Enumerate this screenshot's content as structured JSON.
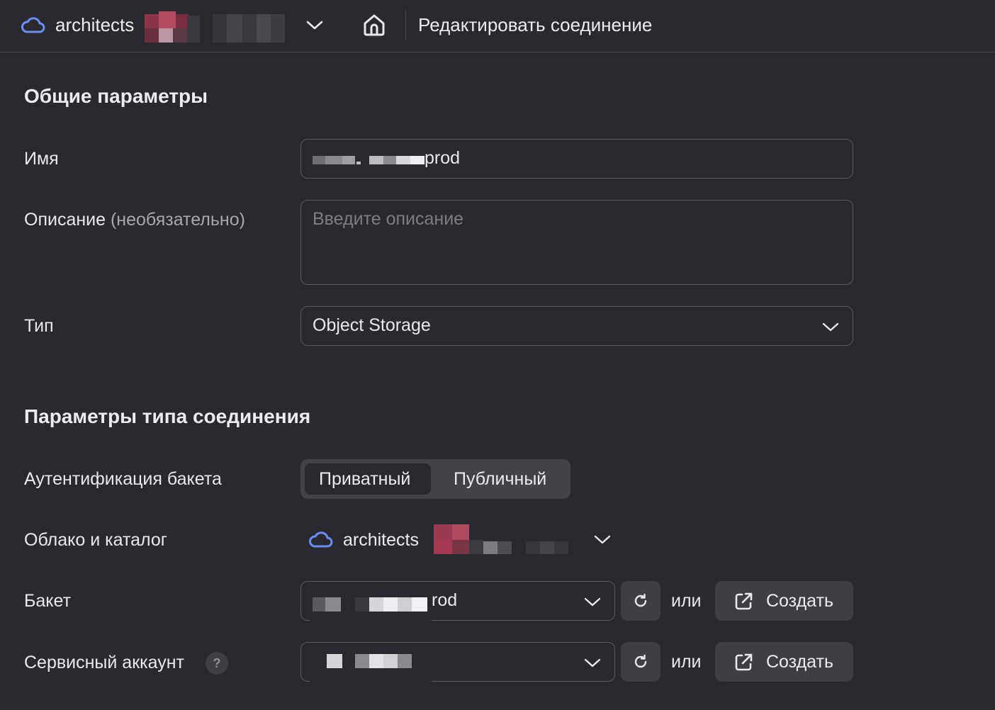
{
  "header": {
    "cloud_name": "architects",
    "page_title": "Редактировать соединение"
  },
  "general": {
    "title": "Общие параметры",
    "name_label": "Имя",
    "name_value": "prod",
    "description_label": "Описание",
    "description_optional": "(необязательно)",
    "description_placeholder": "Введите описание",
    "type_label": "Тип",
    "type_value": "Object Storage"
  },
  "connection": {
    "title": "Параметры типа соединения",
    "auth_label": "Аутентификация бакета",
    "auth_options": [
      "Приватный",
      "Публичный"
    ],
    "auth_selected": "Приватный",
    "cloud_label": "Облако и каталог",
    "cloud_name": "architects",
    "bucket_label": "Бакет",
    "bucket_value": "rod",
    "sa_label": "Сервисный аккаунт",
    "sa_help": "?",
    "or_text": "или",
    "create_label": "Создать"
  },
  "colors": {
    "background": "#2a292f",
    "accent_cloud": "#6b8cf0",
    "border": "#5a595f"
  }
}
